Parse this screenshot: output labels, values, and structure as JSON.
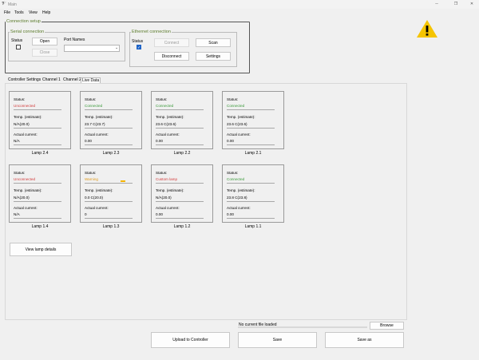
{
  "window": {
    "title": "Main",
    "app_icon": "app-logo-icon",
    "controls": [
      "─",
      "❐",
      "✕"
    ]
  },
  "menu": [
    "File",
    "Tools",
    "View",
    "Help"
  ],
  "connection_setup": {
    "title": "Connection setup",
    "serial": {
      "title": "Serial connection",
      "status_label": "Status",
      "status_checked": false,
      "port_names_label": "Port Names",
      "port_value": "",
      "open_label": "Open",
      "close_label": "Close"
    },
    "ethernet": {
      "title": "Ethernet connection",
      "status_label": "Status",
      "status_checked": true,
      "connect_label": "Connect",
      "scan_label": "Scan",
      "disconnect_label": "Disconnect",
      "settings_label": "Settings"
    }
  },
  "warning_icon": "warning-triangle-icon",
  "tabs": [
    "Controller Settings",
    "Channel 1",
    "Channel 2",
    "Live Data"
  ],
  "active_tab": "Live Data",
  "labels": {
    "status": "Status:",
    "temp": "Temp. (estimate):",
    "current": "Actual current:"
  },
  "lamps": [
    {
      "name": "Lamp 2.4",
      "status": "Unconnected",
      "status_color": "#d23a3a",
      "temp": "N/A(20.0)",
      "current": "N/A"
    },
    {
      "name": "Lamp 2.3",
      "status": "Connected",
      "status_color": "#3a9a3a",
      "temp": "23.7 C(23.7)",
      "current": "0.00"
    },
    {
      "name": "Lamp 2.2",
      "status": "Connected",
      "status_color": "#3a9a3a",
      "temp": "23.6 C(23.6)",
      "current": "0.00"
    },
    {
      "name": "Lamp 2.1",
      "status": "Connected",
      "status_color": "#3a9a3a",
      "temp": "23.6 C(23.6)",
      "current": "0.00"
    },
    {
      "name": "Lamp 1.4",
      "status": "Unconnected",
      "status_color": "#d23a3a",
      "temp": "N/A(20.0)",
      "current": "N/A"
    },
    {
      "name": "Lamp 1.3",
      "status": "Warning",
      "status_color": "#e09a1a",
      "temp": "0.0 C(20.0)",
      "current": "0"
    },
    {
      "name": "Lamp 1.2",
      "status": "Custom lamp",
      "status_color": "#d23a3a",
      "temp": "N/A(20.0)",
      "current": "0.00"
    },
    {
      "name": "Lamp 1.1",
      "status": "Connected",
      "status_color": "#3a9a3a",
      "temp": "23.8 C(23.8)",
      "current": "0.00"
    }
  ],
  "view_details_label": "View lamp details",
  "file_status": "No current file loaded",
  "browse_label": "Browse",
  "upload_label": "Upload to Controller",
  "save_label": "Save",
  "save_as_label": "Save as"
}
